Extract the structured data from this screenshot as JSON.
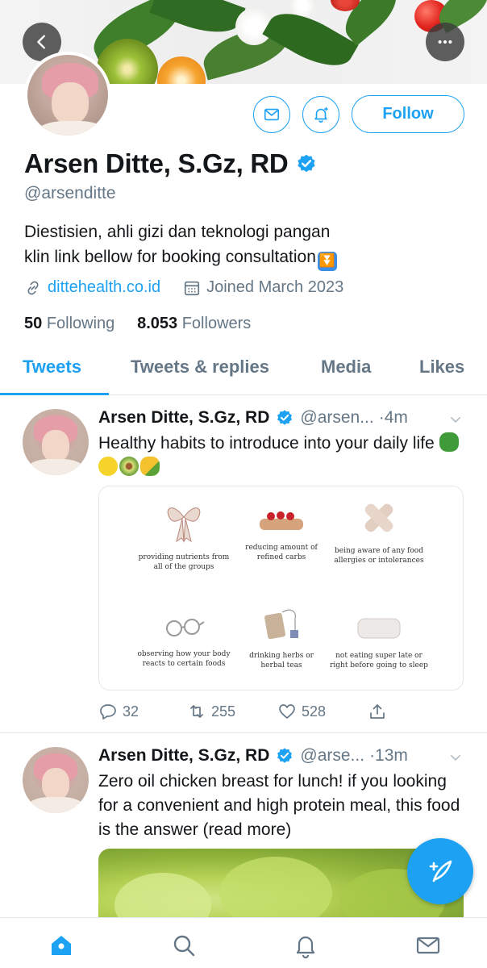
{
  "colors": {
    "accent": "#1da1f2",
    "text": "#14171a",
    "muted": "#657786",
    "divider": "#e1e8ed"
  },
  "header": {
    "back_icon": "chevron-left-icon",
    "more_icon": "more-horizontal-icon",
    "message_icon": "mail-icon",
    "notify_icon": "bell-plus-icon",
    "follow_label": "Follow"
  },
  "profile": {
    "name": "Arsen Ditte, S.Gz, RD",
    "handle": "@arsenditte",
    "bio_line1": "Diestisien, ahli gizi dan teknologi pangan",
    "bio_line2": "klin link bellow for booking consultation",
    "website": "dittehealth.co.id",
    "joined": "Joined March 2023",
    "following_count": "50",
    "following_label": "Following",
    "followers_count": "8.053",
    "followers_label": "Followers"
  },
  "tabs": [
    {
      "label": "Tweets",
      "active": true
    },
    {
      "label": "Tweets & replies",
      "active": false
    },
    {
      "label": "Media",
      "active": false
    },
    {
      "label": "Likes",
      "active": false
    }
  ],
  "tweets": [
    {
      "name": "Arsen Ditte, S.Gz, RD",
      "handle": "@arsen...",
      "time": "·4m",
      "text": "Healthy habits to introduce into your daily life",
      "emojis": [
        "broccoli",
        "lemon",
        "avocado",
        "corn"
      ],
      "card_items": [
        {
          "line1": "providing nutrients from",
          "line2": "all of the groups",
          "pic": "ribbon"
        },
        {
          "line1": "reducing amount of",
          "line2": "refined carbs",
          "pic": "cake"
        },
        {
          "line1": "being aware of any food",
          "line2": "allergies or intolerances",
          "pic": "bandage"
        },
        {
          "line1": "observing how your body",
          "line2": "reacts to certain foods",
          "pic": "glasses"
        },
        {
          "line1": "drinking herbs or",
          "line2": "herbal teas",
          "pic": "teabag"
        },
        {
          "line1": "not eating super late or",
          "line2": "right before going to sleep",
          "pic": "pillow"
        }
      ],
      "replies": "32",
      "retweets": "255",
      "likes": "528"
    },
    {
      "name": "Arsen Ditte, S.Gz, RD",
      "handle": "@arse...",
      "time": "·13m",
      "text": "Zero oil chicken breast for lunch! if you looking for a convenient and high protein meal, this food is the answer (read more)"
    }
  ],
  "compose_icon": "feather-plus-icon",
  "bottom_nav": [
    "home-icon",
    "search-icon",
    "notifications-icon",
    "messages-icon"
  ]
}
